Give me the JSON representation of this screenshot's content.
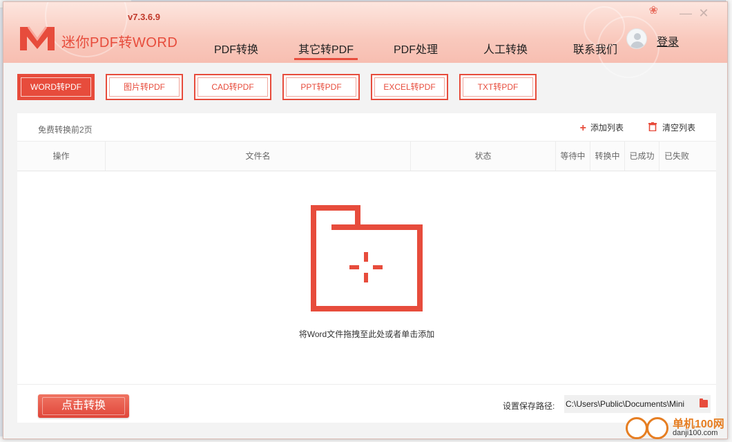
{
  "app": {
    "name": "迷你PDF转WORD",
    "version": "v7.3.6.9",
    "login": "登录"
  },
  "topnav": [
    {
      "label": "PDF转换",
      "active": false
    },
    {
      "label": "其它转PDF",
      "active": true
    },
    {
      "label": "PDF处理",
      "active": false
    },
    {
      "label": "人工转换",
      "active": false
    },
    {
      "label": "联系我们",
      "active": false
    }
  ],
  "subtabs": [
    {
      "label": "WORD转PDF",
      "active": true
    },
    {
      "label": "图片转PDF",
      "active": false
    },
    {
      "label": "CAD转PDF",
      "active": false
    },
    {
      "label": "PPT转PDF",
      "active": false
    },
    {
      "label": "EXCEL转PDF",
      "active": false
    },
    {
      "label": "TXT转PDF",
      "active": false
    }
  ],
  "panel": {
    "free_note": "免费转换前2页",
    "add_list": "添加列表",
    "clear_list": "清空列表",
    "columns": [
      "操作",
      "文件名",
      "状态",
      "等待中",
      "转换中",
      "已成功",
      "已失败"
    ],
    "drop_hint": "将Word文件拖拽至此处或者单击添加"
  },
  "footer": {
    "convert": "点击转换",
    "save_label": "设置保存路径:",
    "save_path": "C:\\Users\\Public\\Documents\\Mini"
  },
  "watermark": {
    "title": "单机100网",
    "url": "danji100.com"
  },
  "colors": {
    "accent": "#e74c3c",
    "header_bg": "#f9c9bd",
    "panel_bg": "#ffffff"
  },
  "icons": {
    "logo": "m-logo-icon",
    "add": "plus-icon",
    "clear": "trash-icon",
    "drop": "folder-add-icon",
    "save": "folder-icon",
    "user": "user-avatar-icon"
  }
}
